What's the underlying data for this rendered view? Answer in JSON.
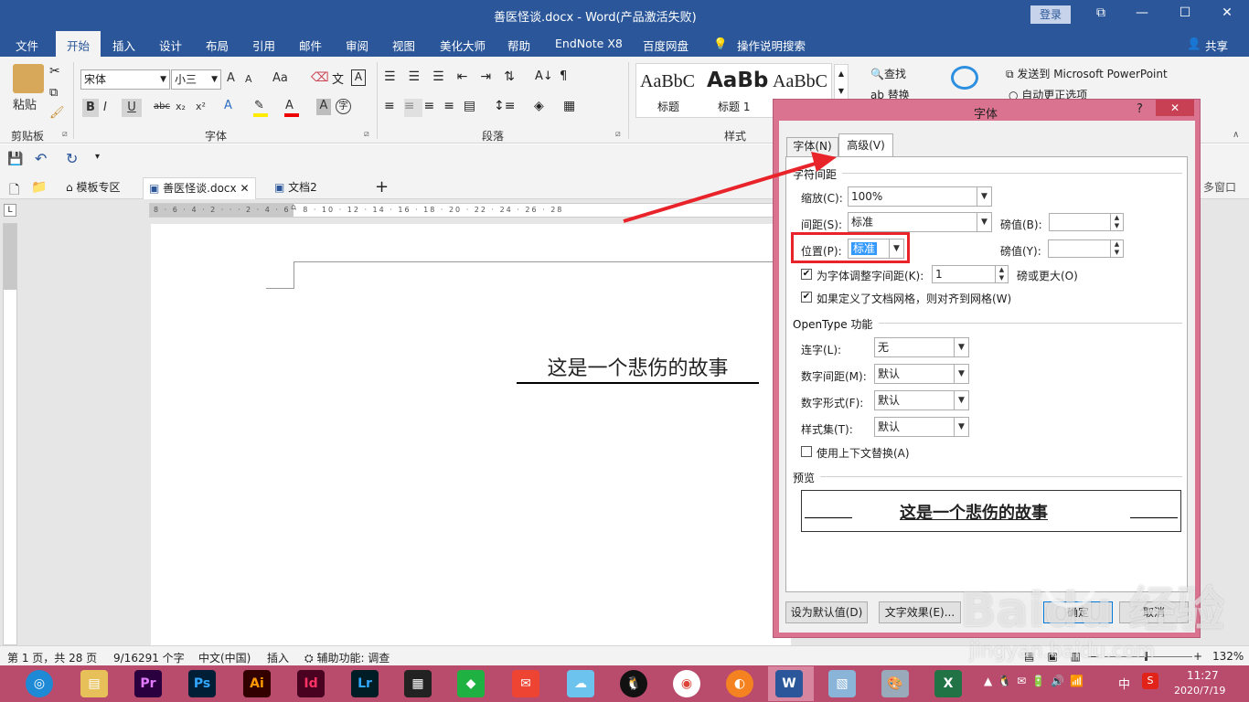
{
  "window": {
    "title": "善医怪谈.docx  -  Word(产品激活失败)",
    "login": "登录",
    "btn_restore": "⧉",
    "btn_min": "—",
    "btn_max": "☐",
    "btn_close": "✕"
  },
  "menu": {
    "items": [
      "文件",
      "开始",
      "插入",
      "设计",
      "布局",
      "引用",
      "邮件",
      "审阅",
      "视图",
      "美化大师",
      "帮助",
      "EndNote X8",
      "百度网盘",
      "操作说明搜索"
    ],
    "share": "共享"
  },
  "ribbon": {
    "paste": "粘贴",
    "clipboard": "剪贴板",
    "font_name": "宋体",
    "font_size": "小三",
    "font_group": "字体",
    "paragraph_group": "段落",
    "styles_group": "样式",
    "styles": [
      {
        "preview": "AaBbC",
        "name": "标题"
      },
      {
        "preview": "AaBb",
        "name": "标题 1"
      },
      {
        "preview": "AaBbC",
        "name": ""
      }
    ],
    "find": "查找",
    "replace": "替换",
    "send_ppt": "发送到 Microsoft PowerPoint",
    "autocorrect": "自动更正选项",
    "grow": "A",
    "shrink": "A",
    "case": "Aa",
    "bold": "B",
    "italic": "I",
    "underline": "U",
    "strike": "abc",
    "sub": "x₂",
    "sup": "x²",
    "text_effect": "A",
    "font_color": "A",
    "char_shade": "A"
  },
  "qat": {
    "tabs": [
      "模板专区",
      "善医怪谈.docx",
      "文档2"
    ],
    "right_label": "多窗口"
  },
  "document": {
    "heading": "这是一个悲伤的故事"
  },
  "status": {
    "page": "第 1 页，共 28 页",
    "words": "9/16291 个字",
    "lang": "中文(中国)",
    "mode": "插入",
    "access": "辅助功能: 调查",
    "zoom": "132%",
    "minus": "—",
    "plus": "+"
  },
  "taskbar": {
    "apps": [
      "Pr",
      "Ps",
      "Ai",
      "Id",
      "Lr"
    ],
    "time": "11:27",
    "date": "2020/7/19",
    "ime": "中"
  },
  "dialog": {
    "title": "字体",
    "help": "?",
    "close": "✕",
    "tab_font": "字体(N)",
    "tab_advanced": "高级(V)",
    "sec_spacing": "字符间距",
    "scale_label": "缩放(C):",
    "scale_value": "100%",
    "spacing_label": "间距(S):",
    "spacing_value": "标准",
    "pt_label_b": "磅值(B):",
    "position_label": "位置(P):",
    "position_value": "标准",
    "pt_label_y": "磅值(Y):",
    "kerning_label": "为字体调整字间距(K):",
    "kerning_value": "1",
    "kerning_suffix": "磅或更大(O)",
    "grid_label": "如果定义了文档网格，则对齐到网格(W)",
    "sec_opentype": "OpenType 功能",
    "lig_label": "连字(L):",
    "lig_value": "无",
    "numspace_label": "数字间距(M):",
    "numspace_value": "默认",
    "numform_label": "数字形式(F):",
    "numform_value": "默认",
    "styleset_label": "样式集(T):",
    "styleset_value": "默认",
    "contextual_label": "使用上下文替换(A)",
    "sec_preview": "预览",
    "preview_text": "这是一个悲伤的故事",
    "btn_default": "设为默认值(D)",
    "btn_effects": "文字效果(E)...",
    "btn_ok": "确定",
    "btn_cancel": "取消"
  },
  "watermark": {
    "brand": "Baidu 经验",
    "url": "jingyan.baidu.com"
  },
  "colors": {
    "word_blue": "#2b579a",
    "dialog_frame": "#d9738f",
    "highlight_red": "#e8232a",
    "taskbar": "#b94c6c"
  }
}
